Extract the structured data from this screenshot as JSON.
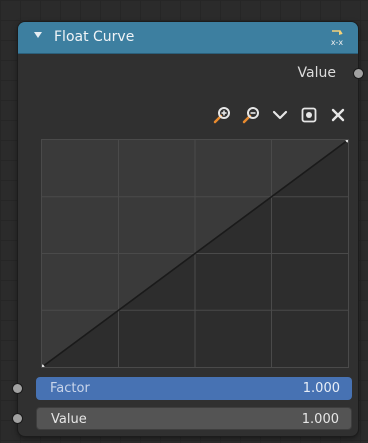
{
  "node": {
    "title": "Float Curve",
    "header_color": "#3d7fa0",
    "header_icon": "node-group-icon"
  },
  "output": {
    "label": "Value"
  },
  "toolbar": {
    "icons": [
      "zoom-in-icon",
      "zoom-out-icon",
      "chevron-down-icon",
      "clipping-icon",
      "close-icon"
    ]
  },
  "curve": {
    "points": [
      [
        0,
        0
      ],
      [
        1,
        1
      ]
    ],
    "grid_divisions": 4
  },
  "inputs": {
    "factor": {
      "label": "Factor",
      "value": "1.000",
      "color": "#4772b3"
    },
    "value": {
      "label": "Value",
      "value": "1.000"
    }
  }
}
